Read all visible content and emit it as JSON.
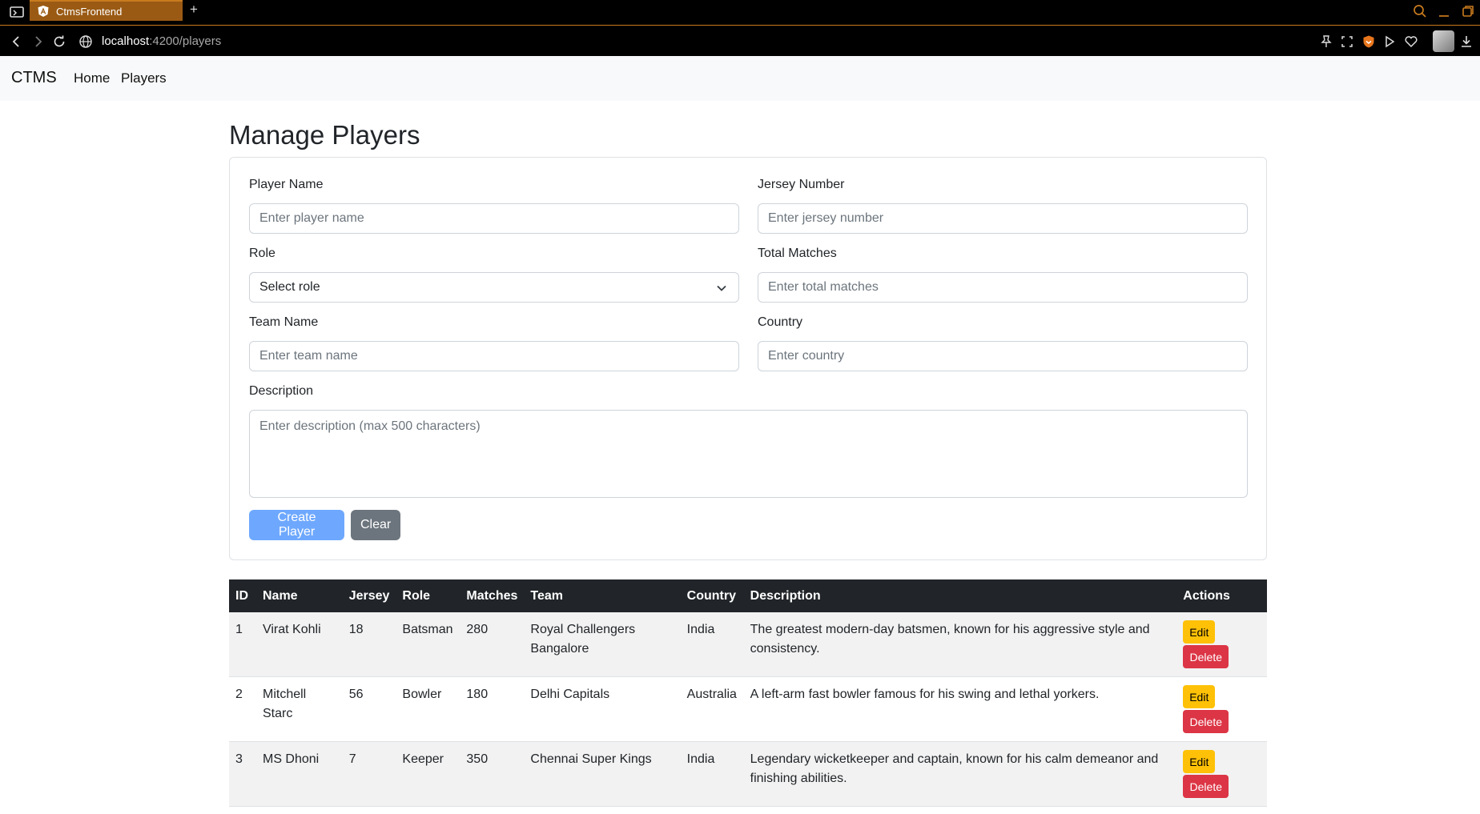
{
  "browser": {
    "tab_title": "CtmsFrontend",
    "new_tab": "+",
    "url_host": "localhost",
    "url_path": ":4200/players",
    "accent": "#c87a1e"
  },
  "navbar": {
    "brand": "CTMS",
    "links": [
      "Home",
      "Players"
    ]
  },
  "page": {
    "title": "Manage Players"
  },
  "form": {
    "player_name": {
      "label": "Player Name",
      "placeholder": "Enter player name"
    },
    "jersey_number": {
      "label": "Jersey Number",
      "placeholder": "Enter jersey number"
    },
    "role": {
      "label": "Role",
      "value": "Select role"
    },
    "total_matches": {
      "label": "Total Matches",
      "placeholder": "Enter total matches"
    },
    "team_name": {
      "label": "Team Name",
      "placeholder": "Enter team name"
    },
    "country": {
      "label": "Country",
      "placeholder": "Enter country"
    },
    "description": {
      "label": "Description",
      "placeholder": "Enter description (max 500 characters)"
    },
    "create_label": "Create Player",
    "clear_label": "Clear"
  },
  "table": {
    "headers": [
      "ID",
      "Name",
      "Jersey",
      "Role",
      "Matches",
      "Team",
      "Country",
      "Description",
      "Actions"
    ],
    "edit_label": "Edit",
    "delete_label": "Delete",
    "rows": [
      {
        "id": "1",
        "name": "Virat Kohli",
        "jersey": "18",
        "role": "Batsman",
        "matches": "280",
        "team": "Royal Challengers Bangalore",
        "country": "India",
        "description": "The greatest modern-day batsmen, known for his aggressive style and consistency."
      },
      {
        "id": "2",
        "name": "Mitchell Starc",
        "jersey": "56",
        "role": "Bowler",
        "matches": "180",
        "team": "Delhi Capitals",
        "country": "Australia",
        "description": "A left-arm fast bowler famous for his swing and lethal yorkers."
      },
      {
        "id": "3",
        "name": "MS Dhoni",
        "jersey": "7",
        "role": "Keeper",
        "matches": "350",
        "team": "Chennai Super Kings",
        "country": "India",
        "description": "Legendary wicketkeeper and captain, known for his calm demeanor and finishing abilities."
      }
    ]
  },
  "colors": {
    "primary_button": "#6ea8fe",
    "secondary_button": "#6c757d",
    "edit": "#ffc107",
    "delete": "#dc3545",
    "table_header": "#212529"
  }
}
